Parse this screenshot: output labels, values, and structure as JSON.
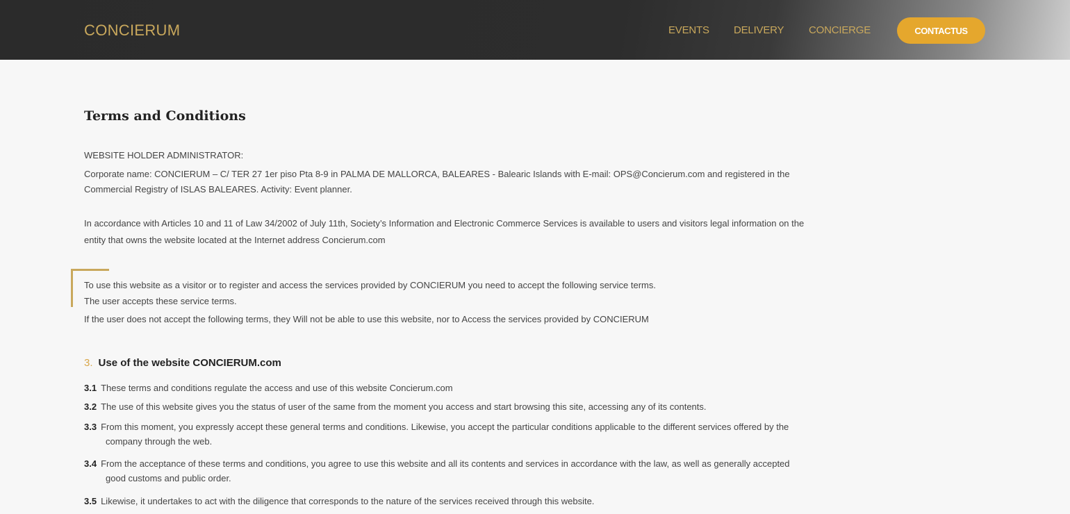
{
  "header": {
    "brand": "CONCIERUM",
    "nav": [
      "EVENTS",
      "DELIVERY",
      "CONCIERGE"
    ],
    "contact_label": "CONTACTUS"
  },
  "colors": {
    "gold": "#c9a85c",
    "button": "#e5a72d",
    "nav_bg": "#2b2b2b"
  },
  "main": {
    "title": "Terms and Conditions",
    "admin_label": "WEBSITE HOLDER ADMINISTRATOR:",
    "corporate_line1": "Corporate name: CONCIERUM – C/ TER 27 1er piso Pta 8-9 in PALMA DE MALLORCA, BALEARES - Balearic Islands with E-mail: OPS@Concierum.com and registered in the",
    "corporate_line2": "Commercial Registry of ISLAS BALEARES. Activity: Event planner.",
    "accordance_line1": "In accordance with Articles 10 and 11 of Law 34/2002 of July 11th, Society’s Information and Electronic Commerce Services is available to users and visitors legal information on the",
    "accordance_line2": "entity that owns the website located at the Internet address Concierum.com",
    "callout_line1": "To use this website as a visitor or to register and access the services provided by CONCIERUM you need to accept the following service terms.",
    "callout_line2": "The user accepts these service terms.",
    "callout_line3": "If the user does not accept the following terms, they Will not be able to use this website, nor to Access the services provided by CONCIERUM",
    "section": {
      "number": "3.",
      "title": "Use of the website CONCIERUM.com",
      "clauses": [
        {
          "num": "3.1",
          "line1": "These terms and conditions regulate the access and use of this website Concierum.com",
          "line2": ""
        },
        {
          "num": "3.2",
          "line1": "The use of this website gives you the status of user of the same from the moment you access and start browsing this site, accessing any of its contents.",
          "line2": ""
        },
        {
          "num": "3.3",
          "line1": "From this moment, you expressly accept these general terms and conditions. Likewise, you accept the particular conditions applicable to the different services offered by the",
          "line2": "company through the web."
        },
        {
          "num": "3.4",
          "line1": "From the acceptance of these terms and conditions, you agree to use this website and all its contents and services in accordance with the law, as well as generally accepted",
          "line2": "good customs and public order."
        },
        {
          "num": "3.5",
          "line1": "Likewise, it undertakes to act with the diligence that corresponds to the nature of the services received through this website.",
          "line2": ""
        }
      ]
    }
  }
}
